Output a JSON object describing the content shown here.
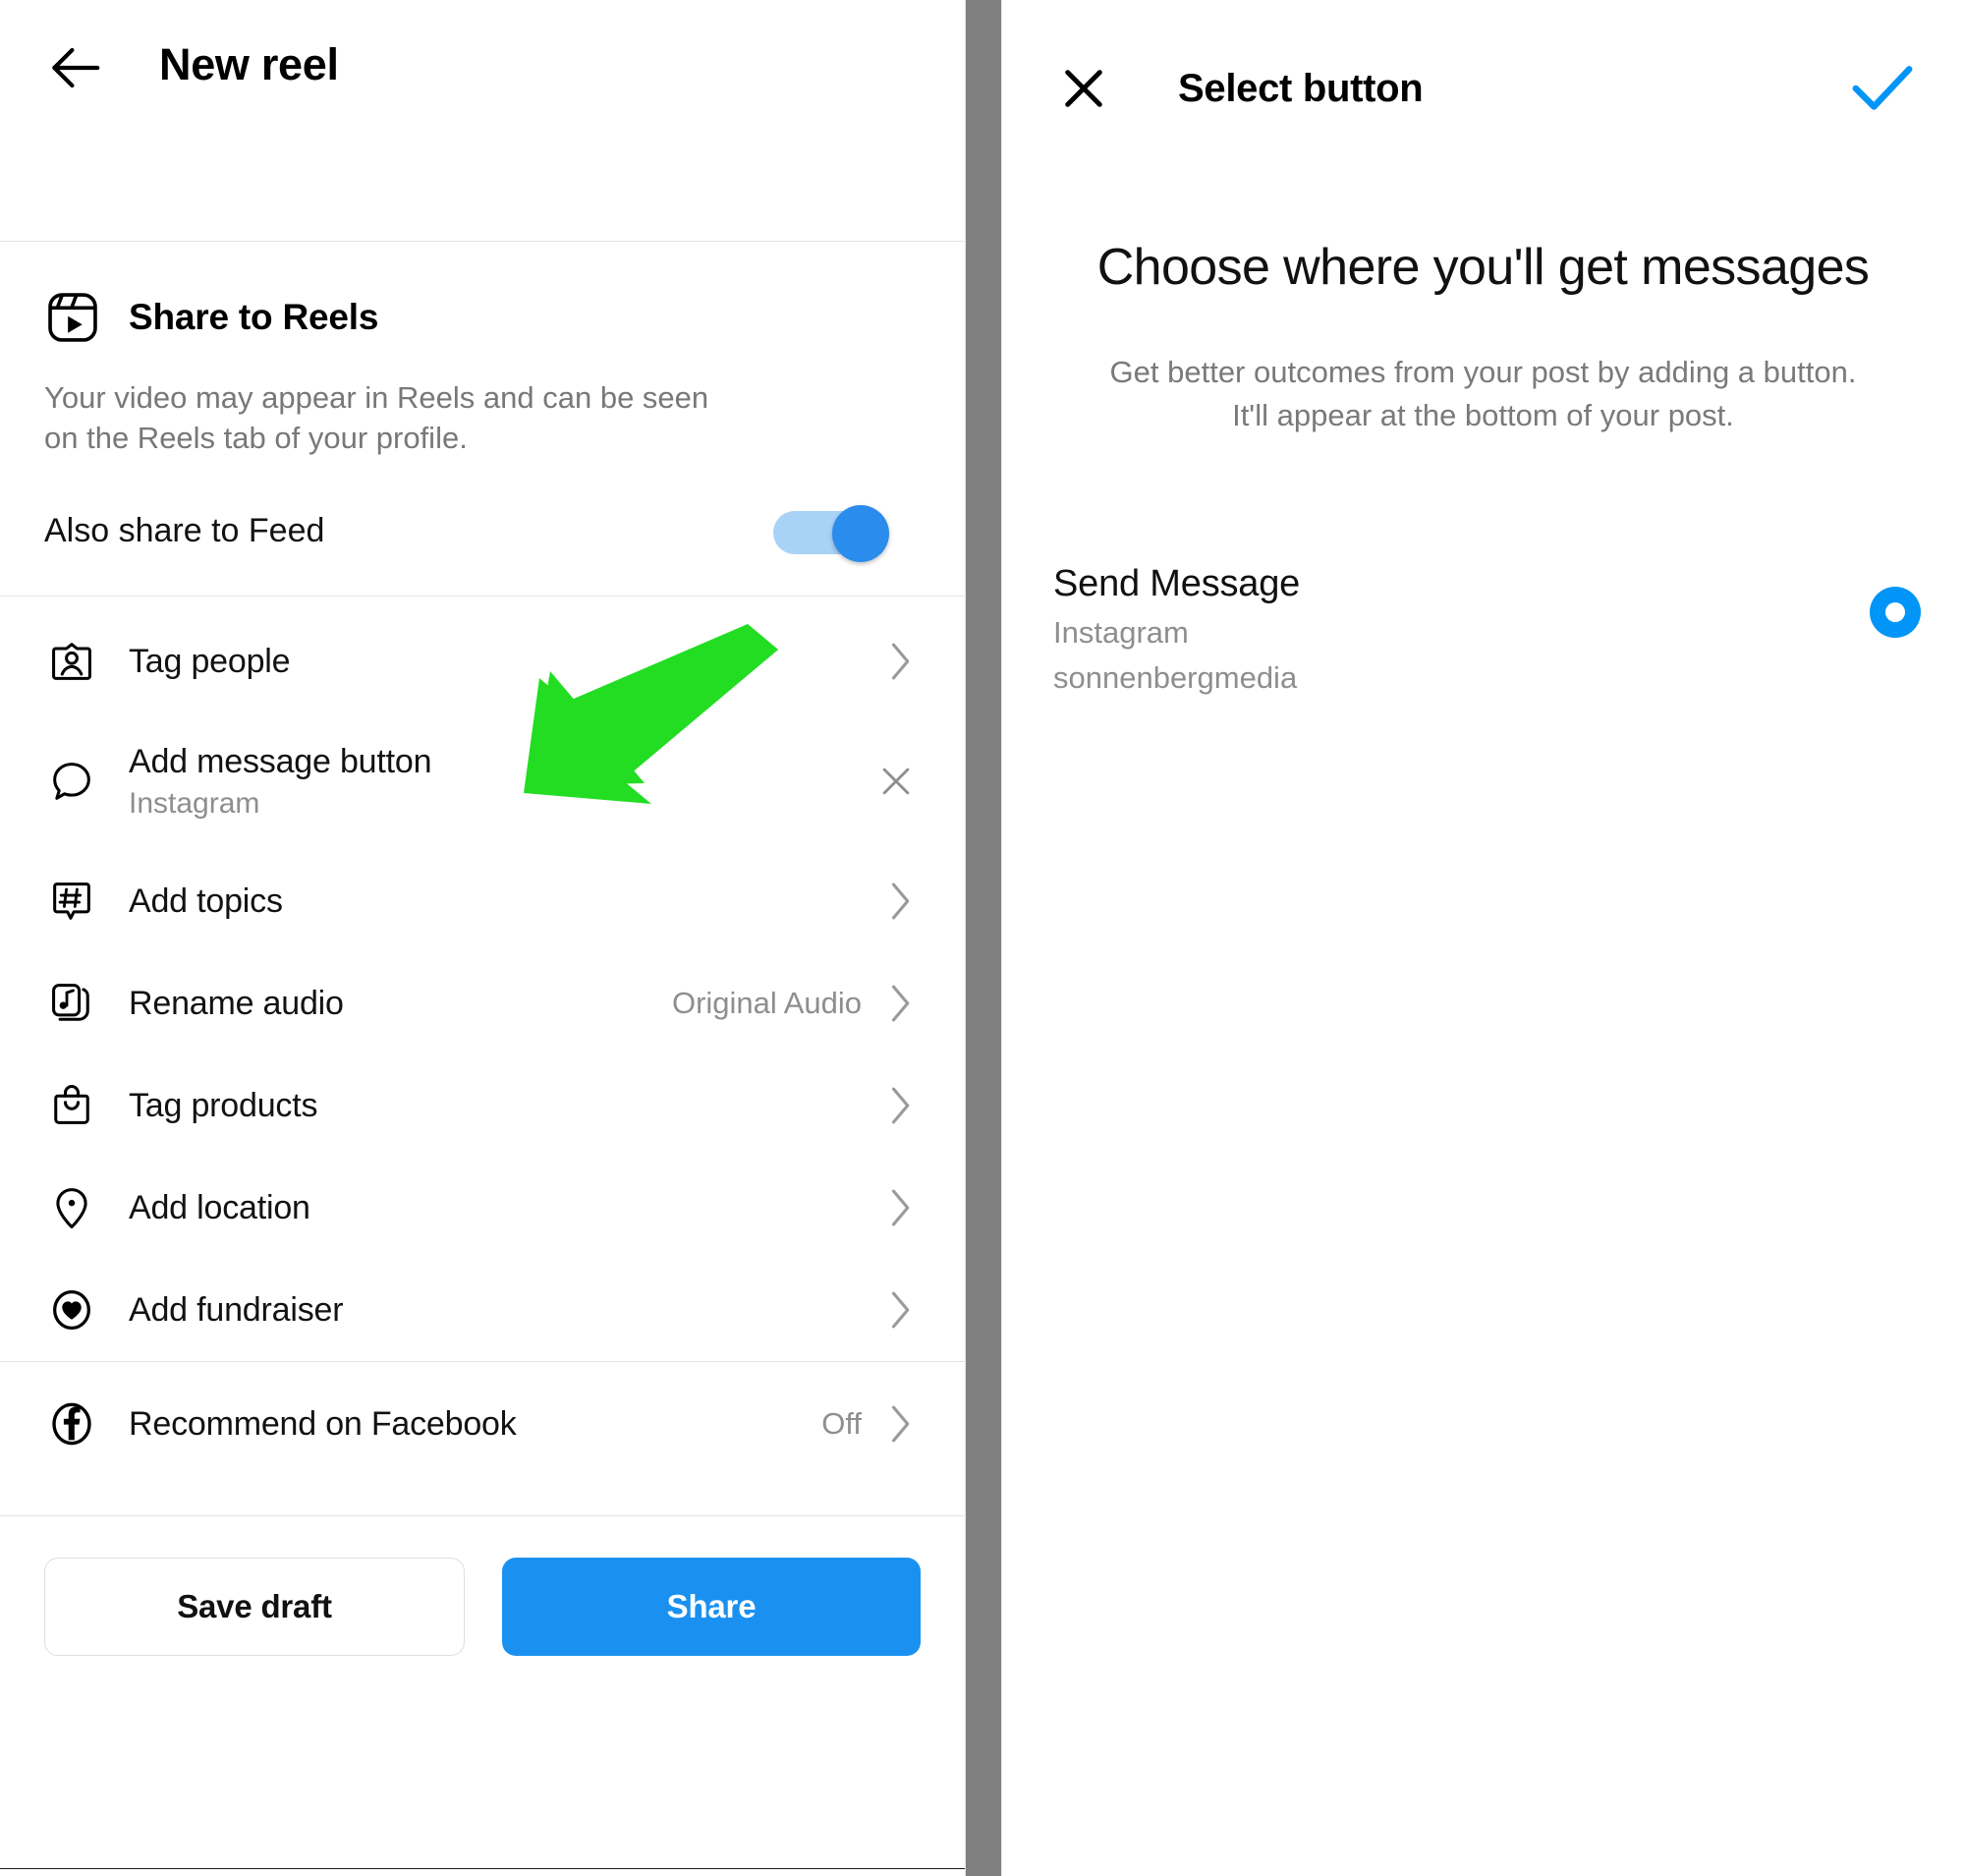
{
  "left": {
    "nav": {
      "back_icon": "arrow-left-icon",
      "title": "New reel"
    },
    "reels_section": {
      "icon": "reels-icon",
      "title": "Share to Reels",
      "description": "Your video may appear in Reels and can be seen on the Reels tab of your profile.",
      "feed_toggle_label": "Also share to Feed",
      "feed_toggle_state": "on"
    },
    "menu_items": [
      {
        "icon": "tag-people-icon",
        "label": "Tag people",
        "value": "",
        "subtitle": "",
        "accessory": "chevron-right-icon"
      },
      {
        "icon": "message-bubble-icon",
        "label": "Add message button",
        "value": "",
        "subtitle": "Instagram",
        "accessory": "close-icon"
      },
      {
        "icon": "hashtag-icon",
        "label": "Add topics",
        "value": "",
        "subtitle": "",
        "accessory": "chevron-right-icon"
      },
      {
        "icon": "audio-note-icon",
        "label": "Rename audio",
        "value": "Original Audio",
        "subtitle": "",
        "accessory": "chevron-right-icon"
      },
      {
        "icon": "shopping-bag-icon",
        "label": "Tag products",
        "value": "",
        "subtitle": "",
        "accessory": "chevron-right-icon"
      },
      {
        "icon": "location-pin-icon",
        "label": "Add location",
        "value": "",
        "subtitle": "",
        "accessory": "chevron-right-icon"
      },
      {
        "icon": "fundraiser-heart-icon",
        "label": "Add fundraiser",
        "value": "",
        "subtitle": "",
        "accessory": "chevron-right-icon"
      }
    ],
    "facebook_row": {
      "icon": "facebook-icon",
      "label": "Recommend on Facebook",
      "value": "Off",
      "accessory": "chevron-right-icon"
    },
    "actions": {
      "save_draft_label": "Save draft",
      "share_label": "Share"
    },
    "annotation": {
      "type": "arrow",
      "color": "#22dd22",
      "points_to": "Add message button"
    }
  },
  "right": {
    "nav": {
      "close_icon": "close-icon",
      "title": "Select button",
      "confirm_icon": "check-icon"
    },
    "hero": {
      "heading": "Choose where you'll get messages",
      "subtitle": "Get better outcomes from your post by adding a button. It'll appear at the bottom of your post."
    },
    "options": [
      {
        "title": "Send Message",
        "platform": "Instagram",
        "account": "sonnenbergmedia",
        "selected": true
      }
    ]
  },
  "colors": {
    "accent_blue": "#0095f6",
    "share_blue": "#1a91f0",
    "toggle_track": "#a9d2f7",
    "toggle_knob": "#2a8cec",
    "annotation_green": "#22dd22",
    "muted_text": "#8e8e8e",
    "gutter_gray": "#808080"
  }
}
